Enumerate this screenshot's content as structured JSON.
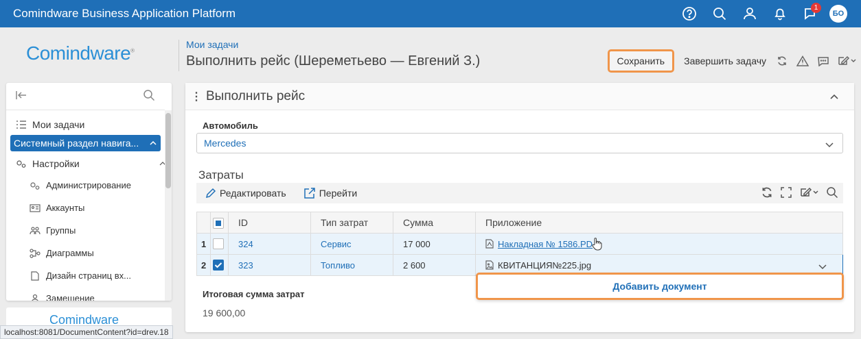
{
  "topbar": {
    "title": "Comindware Business Application Platform",
    "notifications_badge": "1",
    "avatar_initials": "БО"
  },
  "header": {
    "logo": "Comindware",
    "breadcrumb": "Мои задачи",
    "title": "Выполнить рейс (Шереметьево — Евгений З.)",
    "save_label": "Сохранить",
    "finish_label": "Завершить задачу"
  },
  "sidebar": {
    "items": [
      {
        "label": "Мои задачи"
      },
      {
        "label": "Системный раздел навига..."
      },
      {
        "label": "Настройки"
      }
    ],
    "subitems": [
      {
        "label": "Администрирование"
      },
      {
        "label": "Аккаунты"
      },
      {
        "label": "Группы"
      },
      {
        "label": "Диаграммы"
      },
      {
        "label": "Дизайн страниц вх..."
      },
      {
        "label": "Замещение"
      }
    ],
    "bottom_logo": "Comindware"
  },
  "statusbar": "localhost:8081/DocumentContent?id=drev.18",
  "panel": {
    "title": "Выполнить рейс",
    "car_label": "Автомобиль",
    "car_value": "Mercedes",
    "costs_title": "Затраты",
    "toolbar": {
      "edit": "Редактировать",
      "goto": "Перейти"
    },
    "columns": [
      "ID",
      "Тип затрат",
      "Сумма",
      "Приложение"
    ],
    "rows": [
      {
        "n": "1",
        "id": "324",
        "type": "Сервис",
        "sum": "17 000",
        "attachment": "Накладная № 1586.PD",
        "checked": false
      },
      {
        "n": "2",
        "id": "323",
        "type": "Топливо",
        "sum": "2 600",
        "attachment": "КВИТАНЦИЯ№225.jpg",
        "checked": true
      }
    ],
    "add_document": "Добавить документ",
    "total_label": "Итоговая сумма затрат",
    "total_value": "19 600,00"
  }
}
